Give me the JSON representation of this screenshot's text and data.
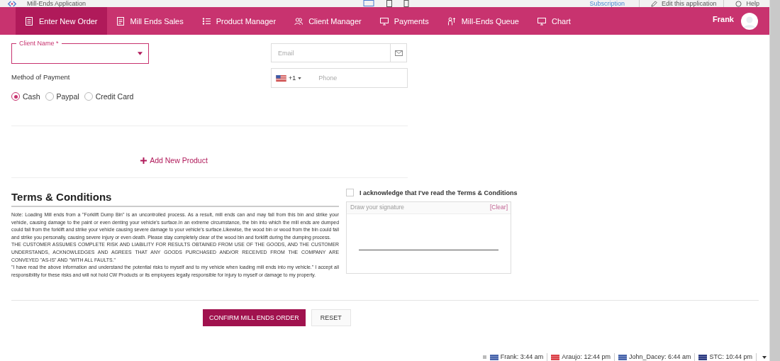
{
  "app_bar": {
    "title": "Mill-Ends Application",
    "links": [
      "Subscription",
      "Edit this application",
      "Help"
    ]
  },
  "nav": {
    "tabs": [
      {
        "label": "Enter New Order",
        "kind": "form",
        "selected": true
      },
      {
        "label": "Mill Ends Sales",
        "kind": "doc",
        "selected": false
      },
      {
        "label": "Product Manager",
        "kind": "list",
        "selected": false
      },
      {
        "label": "Client Manager",
        "kind": "users",
        "selected": false
      },
      {
        "label": "Payments",
        "kind": "monitor",
        "selected": false
      },
      {
        "label": "Mill-Ends Queue",
        "kind": "queue",
        "selected": false
      },
      {
        "label": "Chart",
        "kind": "monitor",
        "selected": false
      }
    ],
    "user": "Frank"
  },
  "form": {
    "client_name": {
      "label": "Client Name *"
    },
    "payment_label": "Method of Payment",
    "payment_options": [
      {
        "label": "Cash",
        "selected": true
      },
      {
        "label": "Paypal",
        "selected": false
      },
      {
        "label": "Credit Card",
        "selected": false
      }
    ],
    "email": {
      "placeholder": "Email"
    },
    "phone": {
      "country_code": "+1",
      "placeholder": "Phone"
    },
    "add_product": "Add New Product"
  },
  "terms": {
    "title": "Terms & Conditions",
    "paragraphs": [
      "Note:  Loading Mill ends from a \"Forklift Dump Bin\" is an uncontrolled process.  As a result, mill ends can and may fall from this bin and strike your vehicle, causing damage to the paint or even denting your vehicle's surface.In an extreme circumstance, the bin into which the mill ends are dumped could fall from the forklift and strike your vehicle causing severe damage to your vehicle's surface.Likewise, the wood bin or wood from the bin could fall and strike you personally, causing severe injury or even death.  Please stay completely clear of the wood bin and forklift during the dumping process.",
      "THE CUSTOMER ASSUMES COMPLETE RISK AND LIABILITY FOR RESULTS OBTAINED FROM USE OF THE GOODS, AND THE CUSTOMER UNDERSTANDS, ACKNOWLEDGES AND AGREES THAT ANY GOODS PURCHASED AND/OR RECEIVED FROM THE COMPANY ARE CONVEYED \"AS-IS\" AND \"WITH ALL FAULTS.\"",
      "\"I have read the above information and understand the potential risks to myself and to my vehicle when loading mill ends into my vehicle.\" I accept all responsibility for these risks and will not hold CW Products or its employees legally responsible for injury to myself or damage to my property."
    ],
    "acknowledge": {
      "label": "I acknowledge that I've read the Terms & Conditions",
      "checked": false
    },
    "signature": {
      "placeholder": "Draw your signature",
      "clear": "[Clear]"
    }
  },
  "buttons": [
    "CONFIRM MILL ENDS ORDER",
    "RESET"
  ],
  "status_bar": [
    {
      "text": "Frank: 3:44 am",
      "color": "#3c5aa6"
    },
    {
      "text": "Araujo: 12:44 pm",
      "color": "#d9363e"
    },
    {
      "text": "John_Dacey: 6:44 am",
      "color": "#3c5aa6"
    },
    {
      "text": "STC: 10:44 pm",
      "color": "#1f2f7a"
    }
  ]
}
